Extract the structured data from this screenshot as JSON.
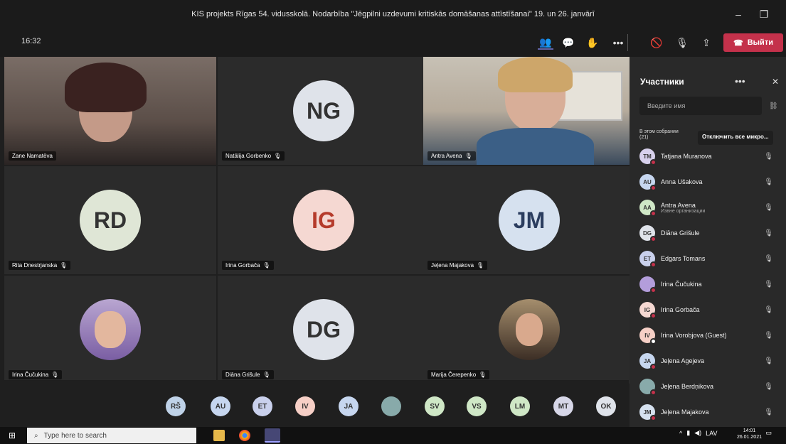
{
  "window": {
    "title": "KIS projekts Rīgas 54. vidusskolā. Nodarbība \"Jēgpilni uzdevumi kritiskās domāšanas attīstīšanai\" 19. un 26. janvārī"
  },
  "toolbar": {
    "clock": "16:32",
    "leave_label": "Выйти"
  },
  "tiles": [
    {
      "name": "Zane Namatēva",
      "type": "video"
    },
    {
      "name": "Natālija Gorbenko",
      "initials": "NG",
      "bg": "#dfe3ea"
    },
    {
      "name": "Antra Avena",
      "type": "video"
    },
    {
      "name": "Rita Dnestrjanska",
      "initials": "RD",
      "bg": "#dfe6d6"
    },
    {
      "name": "Irina Gorbača",
      "initials": "IG",
      "bg": "#f5d8d2"
    },
    {
      "name": "Jeļena Majakova",
      "initials": "JM",
      "bg": "#d6e1ef"
    },
    {
      "name": "Irina Čučukina",
      "type": "photo"
    },
    {
      "name": "Diāna Grišule",
      "initials": "DG",
      "bg": "#dfe3ea"
    },
    {
      "name": "Marija Čerepenko",
      "type": "photo"
    }
  ],
  "overflow": [
    {
      "initials": "RŠ",
      "bg": "#bfd2e8"
    },
    {
      "initials": "AU",
      "bg": "#c6d6ef"
    },
    {
      "initials": "ET",
      "bg": "#c9d0ec"
    },
    {
      "initials": "IV",
      "bg": "#f6cfc6"
    },
    {
      "initials": "JA",
      "bg": "#c6d6ef"
    },
    {
      "initials": "",
      "bg": "#8aa",
      "photo": true
    },
    {
      "initials": "SV",
      "bg": "#cfe7c6"
    },
    {
      "initials": "VS",
      "bg": "#cfe7c6"
    },
    {
      "initials": "LM",
      "bg": "#cfe7c6"
    },
    {
      "initials": "MT",
      "bg": "#d7d7e8"
    },
    {
      "initials": "OK",
      "bg": "#dfe3ea"
    }
  ],
  "panel": {
    "title": "Участники",
    "search_placeholder": "Введите имя",
    "section": "В этом собрании",
    "section_count": "(21)",
    "mute_all": "Отключить все микро..."
  },
  "participants": [
    {
      "initials": "TM",
      "name": "Tatjana Muranova",
      "bg": "#d7d0ec"
    },
    {
      "initials": "AU",
      "name": "Anna Ušakova",
      "bg": "#c6d6ef"
    },
    {
      "initials": "AA",
      "name": "Antra Avena",
      "sub": "Извне организации",
      "bg": "#cfe7c6"
    },
    {
      "initials": "DG",
      "name": "Diāna Grišule",
      "bg": "#dfe3ea"
    },
    {
      "initials": "ET",
      "name": "Edgars Tomans",
      "bg": "#c9d0ec"
    },
    {
      "initials": "",
      "name": "Irina Čučukina",
      "bg": "#b39ddb",
      "photo": true
    },
    {
      "initials": "IG",
      "name": "Irina Gorbača",
      "bg": "#f5d8d2"
    },
    {
      "initials": "IV",
      "name": "Irina Vorobjova (Guest)",
      "bg": "#f6cfc6"
    },
    {
      "initials": "JA",
      "name": "Jeļena Agejeva",
      "bg": "#c6d6ef"
    },
    {
      "initials": "",
      "name": "Jeļena Berdņikova",
      "bg": "#8aa",
      "photo": true
    },
    {
      "initials": "JM",
      "name": "Jeļena Majakova",
      "bg": "#d6e1ef"
    }
  ],
  "taskbar": {
    "search_placeholder": "Type here to search",
    "lang": "LAV",
    "time": "14:01",
    "date": "26.01.2021"
  }
}
